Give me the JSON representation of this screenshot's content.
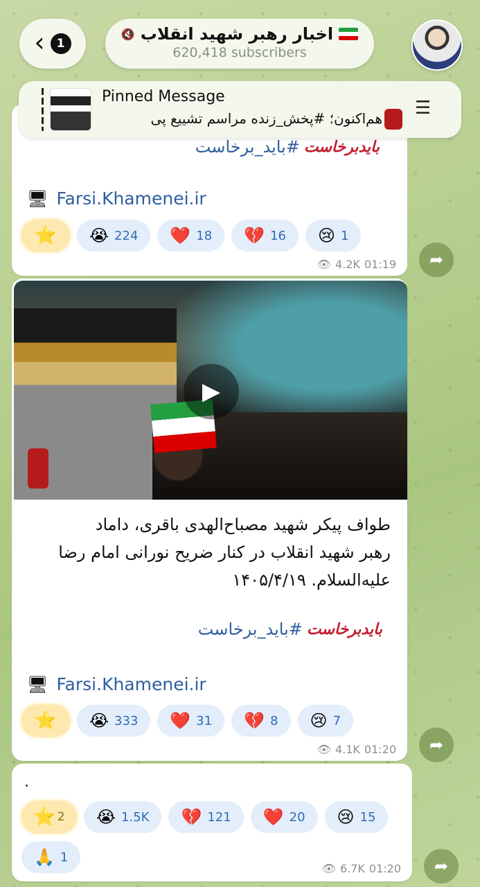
{
  "header": {
    "unread_count": "1",
    "channel_title": "اخبار رهبر شهید انقلاب",
    "subscribers": "620,418 subscribers",
    "pinned_title": "Pinned Message",
    "pinned_text": "هم‌اکنون؛ #پخش_زنده مراسم تشییع پی"
  },
  "messages": [
    {
      "hashtag": "#باید_برخاست",
      "hashtag_logo": "بایدبرخاست",
      "link_text": "Farsi.Khamenei.ir",
      "reactions": [
        {
          "emoji": "⭐",
          "count": ""
        },
        {
          "emoji": "😭",
          "count": "224"
        },
        {
          "emoji": "❤️",
          "count": "18"
        },
        {
          "emoji": "💔",
          "count": "16"
        },
        {
          "emoji": "😢",
          "count": "1"
        }
      ],
      "views": "4.2K",
      "time": "01:19"
    },
    {
      "text_line1": "طواف پیکر شهید مصباح‌الهدی باقری، داماد",
      "text_line2": "رهبر شهید انقلاب در کنار ضریح نورانی امام رضا",
      "text_line3": "علیه‌السلام. ۱۴۰۵/۴/۱۹",
      "hashtag": "#باید_برخاست",
      "hashtag_logo": "بایدبرخاست",
      "link_text": "Farsi.Khamenei.ir",
      "reactions": [
        {
          "emoji": "⭐",
          "count": ""
        },
        {
          "emoji": "😭",
          "count": "333"
        },
        {
          "emoji": "❤️",
          "count": "31"
        },
        {
          "emoji": "💔",
          "count": "8"
        },
        {
          "emoji": "😢",
          "count": "7"
        }
      ],
      "views": "4.1K",
      "time": "01:20"
    },
    {
      "text": ".",
      "reactions": [
        {
          "emoji": "⭐",
          "count": "2"
        },
        {
          "emoji": "😭",
          "count": "1.5K"
        },
        {
          "emoji": "💔",
          "count": "121"
        },
        {
          "emoji": "❤️",
          "count": "20"
        },
        {
          "emoji": "😢",
          "count": "15"
        },
        {
          "emoji": "🙏",
          "count": "1"
        }
      ],
      "views": "6.7K",
      "time": "01:20"
    }
  ],
  "icons": {
    "back": "chevron-left-icon",
    "mute": "muted-speaker-icon",
    "pin_list": "pinned-list-icon",
    "share": "share-arrow-icon",
    "views": "eye-icon",
    "monitor": "monitor-icon",
    "play": "play-icon"
  },
  "colors": {
    "link": "#2f5e9e",
    "reaction_bg": "#e3eefa",
    "reaction_text": "#2f6bb5",
    "star_bg": "#fde9b0",
    "hashtag_logo": "#c21d2f"
  }
}
